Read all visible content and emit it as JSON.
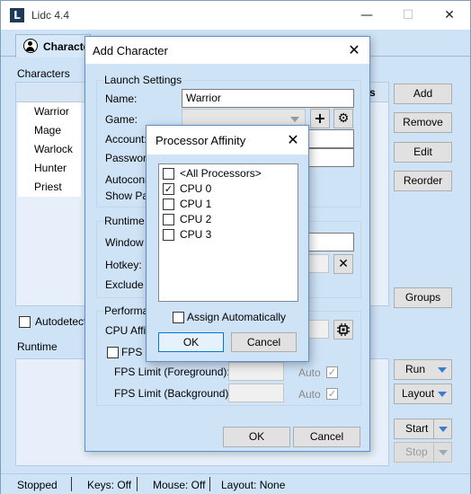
{
  "app": {
    "title": "Lidc 4.4",
    "logo_letter": "L",
    "caption_buttons": {
      "minimize": "—",
      "maximize": "☐",
      "close": "✕"
    }
  },
  "tabs": [
    {
      "label": "Character"
    }
  ],
  "characters_panel": {
    "label": "Characters",
    "header_fragment": "s",
    "items": [
      "Warrior",
      "Mage",
      "Warlock",
      "Hunter",
      "Priest"
    ],
    "buttons": {
      "add": "Add",
      "remove": "Remove",
      "edit": "Edit",
      "reorder": "Reorder",
      "groups": "Groups"
    },
    "autodetect_label": "Autodetect F"
  },
  "runtime_panel": {
    "label": "Runtime",
    "buttons": {
      "run": "Run",
      "layout": "Layout",
      "start": "Start",
      "stop": "Stop"
    }
  },
  "status_bar": {
    "state": "Stopped",
    "keys": "Keys: Off",
    "mouse": "Mouse: Off",
    "layout": "Layout: None"
  },
  "add_character_dialog": {
    "title": "Add Character",
    "close_glyph": "✕",
    "launch_settings": {
      "label": "Launch Settings",
      "name_label": "Name:",
      "name_value": "Warrior",
      "game_label": "Game:",
      "account_label": "Account:",
      "password_label": "Password",
      "autoconnect_label": "Autoconn",
      "show_password_label": "Show Pas",
      "add_glyph": "+",
      "gear_glyph": "⚙"
    },
    "runtime_settings": {
      "label": "Runtime S",
      "window_title_label": "Window T",
      "hotkey_label": "Hotkey:",
      "exclude_label": "Exclude fr",
      "clear_glyph": "✕"
    },
    "performance": {
      "label": "Performan",
      "cpu_affinity_label": "CPU Affin",
      "fps_limit_label": "FPS Li",
      "fps_foreground_label": "FPS Limit (Foreground):",
      "fps_background_label": "FPS Limit (Background):",
      "auto_label": "Auto",
      "check_glyph": "✓"
    },
    "ok_label": "OK",
    "cancel_label": "Cancel"
  },
  "processor_affinity_dialog": {
    "title": "Processor Affinity",
    "close_glyph": "✕",
    "items": [
      {
        "label": "<All Processors>",
        "checked": false,
        "mark": ""
      },
      {
        "label": "CPU 0",
        "checked": true,
        "mark": "✓"
      },
      {
        "label": "CPU 1",
        "checked": false,
        "mark": ""
      },
      {
        "label": "CPU 2",
        "checked": false,
        "mark": ""
      },
      {
        "label": "CPU 3",
        "checked": false,
        "mark": ""
      }
    ],
    "assign_automatically_label": "Assign Automatically",
    "ok_label": "OK",
    "cancel_label": "Cancel"
  },
  "colors": {
    "window_bg": "#cfe3f7",
    "panel_bg": "#e7f0fa",
    "accent": "#0078d7",
    "dropdown_arrow": "#3a7bd5"
  }
}
